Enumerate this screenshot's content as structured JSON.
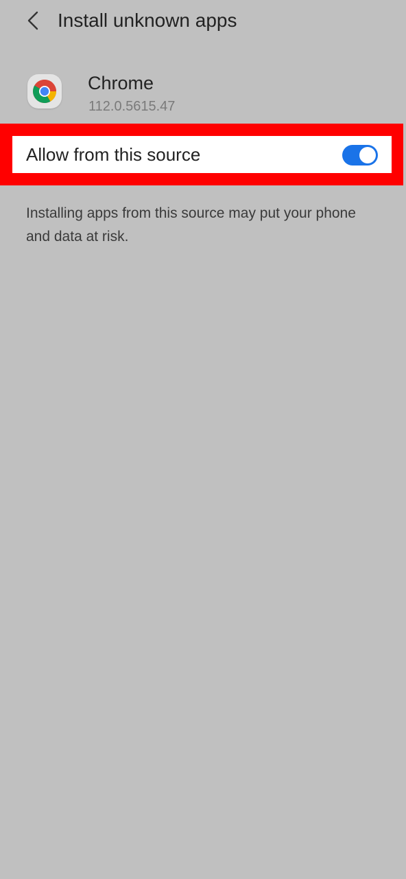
{
  "header": {
    "title": "Install unknown apps"
  },
  "app": {
    "name": "Chrome",
    "version": "112.0.5615.47",
    "icon": "chrome-icon"
  },
  "setting": {
    "label": "Allow from this source",
    "enabled": true
  },
  "description": "Installing apps from this source may put your phone and data at risk.",
  "colors": {
    "background": "#c0c0c0",
    "highlight": "#ff0000",
    "switch_on": "#1a73e8"
  }
}
